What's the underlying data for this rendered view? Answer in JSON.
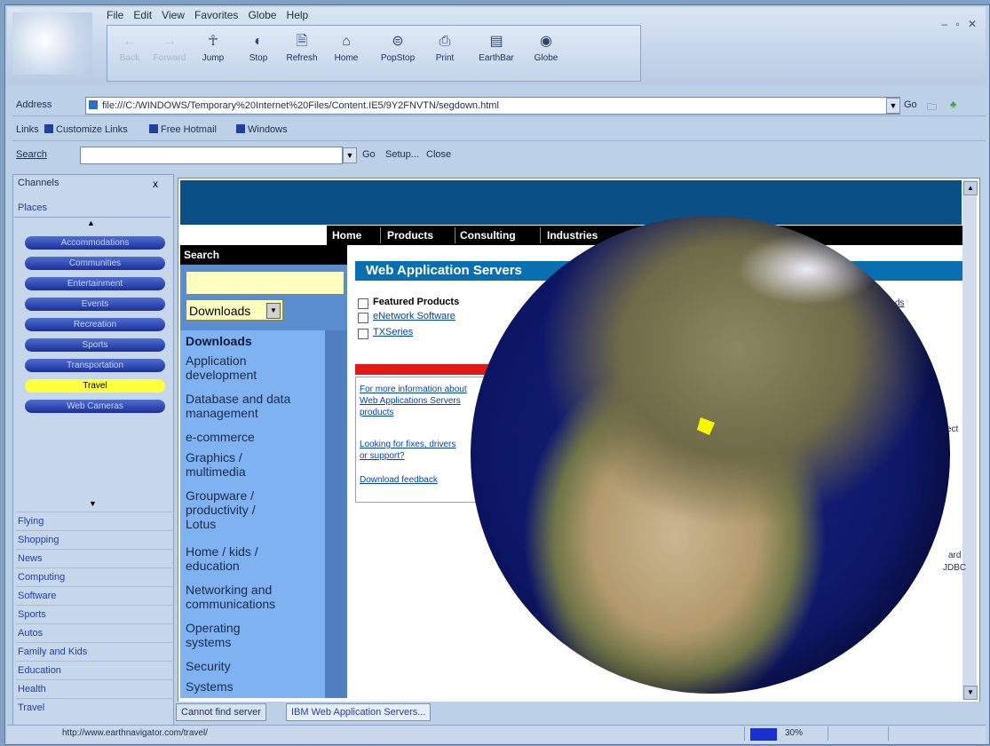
{
  "menu": [
    "File",
    "Edit",
    "View",
    "Favorites",
    "Globe",
    "Help"
  ],
  "toolbar": [
    {
      "label": "Back",
      "icon": "back-arrow-icon",
      "glyph": "←",
      "enabled": false
    },
    {
      "label": "Forward",
      "icon": "forward-arrow-icon",
      "glyph": "→",
      "enabled": false
    },
    {
      "label": "Jump",
      "icon": "jump-figure-icon",
      "glyph": "☥",
      "enabled": true
    },
    {
      "label": "Stop",
      "icon": "stop-icon",
      "glyph": "◐",
      "enabled": true
    },
    {
      "label": "Refresh",
      "icon": "refresh-icon",
      "glyph": "🗎",
      "enabled": true
    },
    {
      "label": "Home",
      "icon": "home-icon",
      "glyph": "⌂",
      "enabled": true
    },
    {
      "label": "PopStop",
      "icon": "popstop-icon",
      "glyph": "⊜",
      "enabled": true
    },
    {
      "label": "Print",
      "icon": "print-icon",
      "glyph": "⎙",
      "enabled": true
    },
    {
      "label": "EarthBar",
      "icon": "earthbar-icon",
      "glyph": "▤",
      "enabled": true
    },
    {
      "label": "Globe",
      "icon": "globe-icon",
      "glyph": "◉",
      "enabled": true
    }
  ],
  "address": {
    "label": "Address",
    "value": "file:///C:/WINDOWS/Temporary%20Internet%20Files/Content.IE5/9Y2FNVTN/segdown.html",
    "go": "Go"
  },
  "links": {
    "label": "Links",
    "items": [
      "Customize Links",
      "Free Hotmail",
      "Windows"
    ]
  },
  "search": {
    "label": "Search",
    "value": "",
    "go": "Go",
    "setup": "Setup...",
    "close": "Close"
  },
  "sidebar": {
    "channels": "Channels",
    "close": "x",
    "places": "Places",
    "places_items": [
      {
        "label": "Accommodations",
        "selected": false
      },
      {
        "label": "Communities",
        "selected": false
      },
      {
        "label": "Entertainment",
        "selected": false
      },
      {
        "label": "Events",
        "selected": false
      },
      {
        "label": "Recreation",
        "selected": false
      },
      {
        "label": "Sports",
        "selected": false
      },
      {
        "label": "Transportation",
        "selected": false
      },
      {
        "label": "Travel",
        "selected": true
      },
      {
        "label": "Web Cameras",
        "selected": false
      }
    ],
    "categories": [
      "Flying",
      "Shopping",
      "News",
      "Computing",
      "Software",
      "Sports",
      "Autos",
      "Family and Kids",
      "Education",
      "Health",
      "Travel"
    ]
  },
  "page": {
    "nav": [
      "Home",
      "Products",
      "Consulting",
      "Industries"
    ],
    "search_heading": "Search",
    "search_select": "Downloads",
    "downloads_title": "Downloads",
    "downloads": [
      "Application development",
      "Database and data management",
      "e-commerce",
      "Graphics / multimedia",
      "Groupware / productivity / Lotus",
      "Home / kids / education",
      "Networking and communications",
      "Operating systems",
      "Security",
      "Systems"
    ],
    "section_title": "Web Application Servers",
    "featured_title": "Featured Products",
    "featured_links": [
      "eNetwork Software",
      "TXSeries"
    ],
    "info_links": [
      "For more information about Web Applications Servers products",
      "Looking for fixes, drivers or support?",
      "Download feedback"
    ],
    "fragments": [
      "ds",
      "ect",
      "ard",
      "JDBC"
    ]
  },
  "tabs": [
    "Cannot find server",
    "IBM Web Application Servers..."
  ],
  "status": {
    "text": "http://www.earthnavigator.com/travel/",
    "progress_percent": 30,
    "progress_text": "30%"
  }
}
